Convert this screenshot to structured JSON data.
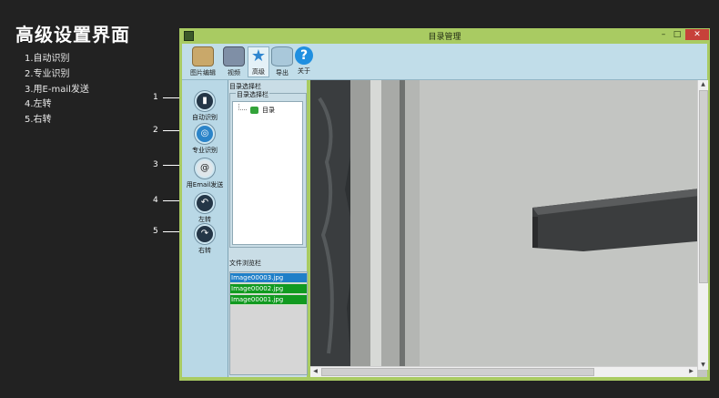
{
  "heading": "高级设置界面",
  "legend": [
    "1.自动识别",
    "2.专业识别",
    "3.用E-mail发送",
    "4.左转",
    "5.右转"
  ],
  "callouts": [
    "1",
    "2",
    "3",
    "4",
    "5"
  ],
  "window": {
    "title": "目录管理",
    "controls": {
      "minimize": "–",
      "maximize": "□",
      "close": "✕"
    }
  },
  "toolbar": {
    "items": [
      {
        "label": "图片编辑",
        "icon": "image-edit-icon",
        "color": "#c9a86a"
      },
      {
        "label": "视频",
        "icon": "video-icon",
        "color": "#7f8fa6"
      },
      {
        "label": "高级",
        "icon": "star-icon",
        "color": "#3a8fd0"
      },
      {
        "label": "导出",
        "icon": "database-export-icon",
        "color": "#a9c8da"
      },
      {
        "label": "关于",
        "icon": "help-icon",
        "color": "#1f8fe0"
      }
    ]
  },
  "left_panel": {
    "buttons": [
      {
        "label": "自动识别",
        "icon": "auto-recognize-icon",
        "glyph": "▮"
      },
      {
        "label": "专业识别",
        "icon": "pro-recognize-icon",
        "glyph": "◎"
      },
      {
        "label": "用Email发送",
        "icon": "email-icon",
        "glyph": "@"
      },
      {
        "label": "左转",
        "icon": "rotate-left-icon",
        "glyph": "↶"
      },
      {
        "label": "右转",
        "icon": "rotate-right-icon",
        "glyph": "↷"
      }
    ]
  },
  "mid_panel": {
    "dir_bar_title": "目录选择栏",
    "dir_group_label": "目录选择栏",
    "tree_root": "目录",
    "file_bar_title": "文件浏览栏",
    "files": [
      {
        "name": "Image00003.jpg",
        "color": "#1f7fc8"
      },
      {
        "name": "Image00002.jpg",
        "color": "#119a20"
      },
      {
        "name": "Image00001.jpg",
        "color": "#119a20"
      }
    ]
  },
  "scroll": {
    "up": "▲",
    "down": "▼",
    "left": "◀",
    "right": "▶"
  }
}
